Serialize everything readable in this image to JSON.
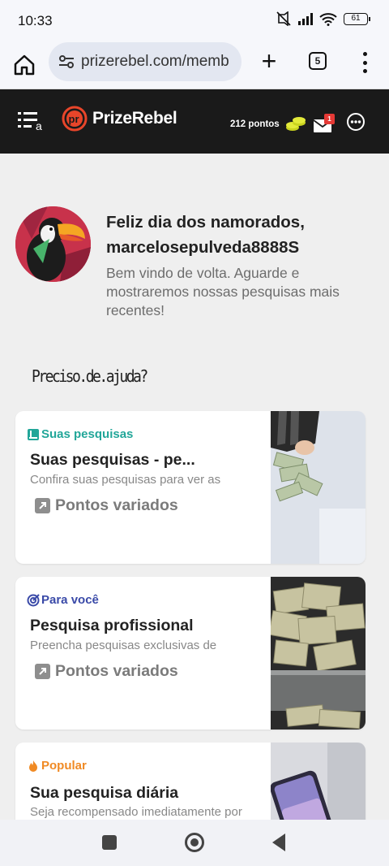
{
  "status": {
    "time": "10:33",
    "battery": "61"
  },
  "browser": {
    "url": "prizerebel.com/memb",
    "tab_count": "5"
  },
  "header": {
    "brand": "PrizeRebel",
    "points": "212 pontos",
    "mail_badge": "1"
  },
  "welcome": {
    "title": "Feliz dia dos namorados, marcelosepulveda8888S",
    "subtitle": "Bem vindo de volta. Aguarde e mostraremos nossas pesquisas mais recentes!"
  },
  "help_link": "Preciso.de.ajuda?",
  "cards": [
    {
      "tag": "Suas pesquisas",
      "tag_color": "#22a699",
      "title": "Suas pesquisas - pe...",
      "desc": "Confira suas pesquisas para ver as",
      "points": "Pontos variados"
    },
    {
      "tag": "Para você",
      "tag_color": "#3a4aa8",
      "title": "Pesquisa profissional",
      "desc": "Preencha pesquisas exclusivas de",
      "points": "Pontos variados"
    },
    {
      "tag": "Popular",
      "tag_color": "#f08a24",
      "title": "Sua pesquisa diária",
      "desc": "Seja recompensado imediatamente por",
      "points": ""
    }
  ]
}
